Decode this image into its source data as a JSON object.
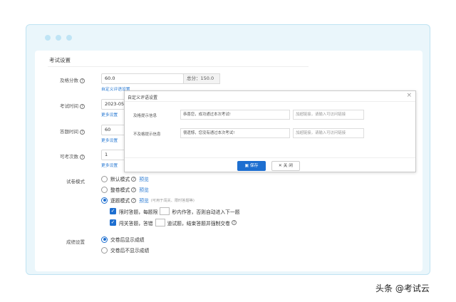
{
  "section_title": "考试设置",
  "pass_score": {
    "label": "及格分数",
    "value": "60.0",
    "total": "总分：150.0",
    "link": "自定义评语设置"
  },
  "exam_time": {
    "label": "考试时间",
    "value": "2023-05-2",
    "link": "更多设置"
  },
  "answer_time": {
    "label": "答题时间",
    "value": "60",
    "link": "更多设置"
  },
  "attempts": {
    "label": "可考次数",
    "value": "1",
    "link": "更多设置"
  },
  "paper_mode": {
    "label": "试卷模式",
    "options": [
      {
        "text": "默认模式",
        "preview": "预览"
      },
      {
        "text": "整卷模式",
        "preview": "预览"
      },
      {
        "text": "逐题模式",
        "preview": "预览",
        "hint": "(可用于闯关、限时答题等)"
      }
    ],
    "sub1": {
      "a": "限时答题，每题限",
      "b": "秒内作答，否则自动进入下一题"
    },
    "sub2": {
      "a": "闯关答题，答错",
      "b": "道试题，结束答题并强制交卷"
    }
  },
  "score_display": {
    "label": "成绩设置",
    "options": [
      "交卷后显示成绩",
      "交卷后不显示成绩"
    ]
  },
  "modal": {
    "title": "自定义评语设置",
    "pass_label": "及格提示信息",
    "pass_value": "恭喜您，成功通过本次考试!",
    "pass_link": "加超链接，请输入可访问链接",
    "fail_label": "不及格提示信息",
    "fail_value": "很遗憾，您没有通过本次考试!",
    "fail_link": "加超链接，请输入可访问链接",
    "save": "保存",
    "close": "关 闭"
  },
  "watermark": "头条 @考试云",
  "colors": {
    "accent": "#1e6fd0",
    "link": "#2b7bd3",
    "frame": "#eaf6fb"
  }
}
